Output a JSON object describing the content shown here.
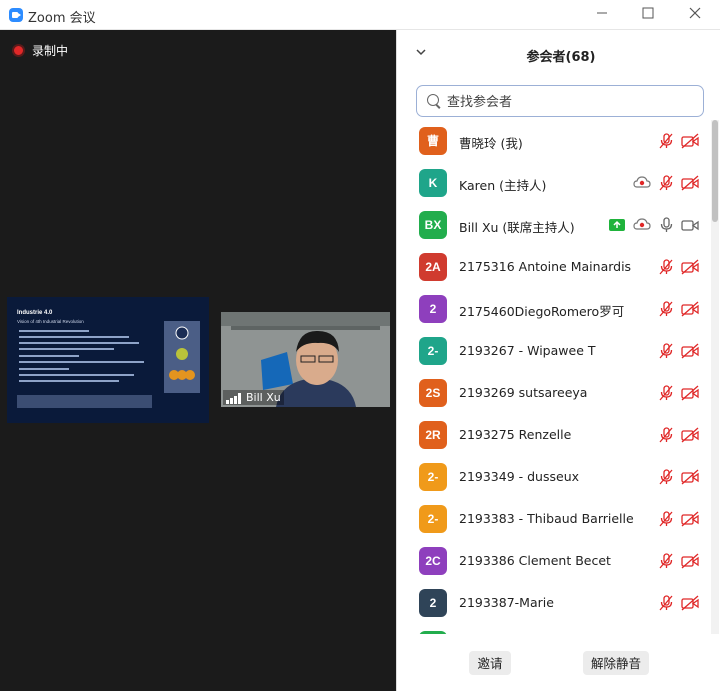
{
  "window": {
    "title": "Zoom 会议"
  },
  "recording": {
    "label": "录制中"
  },
  "shared_slide": {
    "title": "Industrie 4.0",
    "subtitle": "Vision of 4th Industrial Revolution"
  },
  "video_tile": {
    "name": "Bill Xu"
  },
  "participants_panel": {
    "title": "参会者(68)",
    "search_placeholder": "查找参会者",
    "participants": [
      {
        "initials": "曹",
        "name": "曹晓玲 (我)",
        "color": "#e0601c",
        "status": "muted"
      },
      {
        "initials": "K",
        "name": "Karen (主持人)",
        "color": "#1fa58a",
        "status": "muted",
        "cloud": true
      },
      {
        "initials": "BX",
        "name": "Bill Xu (联席主持人)",
        "color": "#22ad4d",
        "status": "active",
        "cloud": true,
        "share": true
      },
      {
        "initials": "2A",
        "name": "2175316 Antoine Mainardis",
        "color": "#d03b2f",
        "status": "muted"
      },
      {
        "initials": "2",
        "name": "2175460DiegoRomero罗可",
        "color": "#8e3fbd",
        "status": "muted"
      },
      {
        "initials": "2-",
        "name": "2193267 - Wipawee T",
        "color": "#1fa58a",
        "status": "muted"
      },
      {
        "initials": "2S",
        "name": "2193269 sutsareeya",
        "color": "#e0601c",
        "status": "muted"
      },
      {
        "initials": "2R",
        "name": "2193275 Renzelle",
        "color": "#e0601c",
        "status": "muted"
      },
      {
        "initials": "2-",
        "name": "2193349 - dusseux",
        "color": "#f09a1a",
        "status": "muted"
      },
      {
        "initials": "2-",
        "name": "2193383 - Thibaud Barrielle",
        "color": "#f09a1a",
        "status": "muted"
      },
      {
        "initials": "2C",
        "name": "2193386  Clement Becet",
        "color": "#8e3fbd",
        "status": "muted"
      },
      {
        "initials": "2",
        "name": "2193387-Marie",
        "color": "#2f4458",
        "status": "muted"
      },
      {
        "initials": "",
        "name": "",
        "color": "#22ad4d",
        "status": "muted"
      }
    ],
    "invite_label": "邀请",
    "unmute_label": "解除静音"
  },
  "colors": {
    "muted_red": "#e02828",
    "video_bg": "#1b1b1b",
    "share_green": "#1fb33c"
  }
}
